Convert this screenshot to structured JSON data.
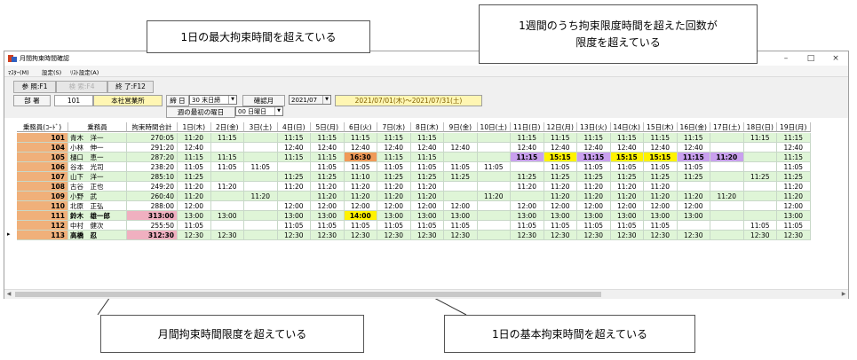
{
  "window": {
    "title": "月間拘束時間確認",
    "controls": [
      "–",
      "□",
      "×"
    ]
  },
  "menu": [
    "ﾏｽﾀｰ(M)",
    "設定(S)",
    "ﾘｽﾄ設定(A)"
  ],
  "toolbar": {
    "ref": "参 照:F1",
    "search": "検 索:F4",
    "exit": "終 了:F12"
  },
  "filters": {
    "dept_label": "部 署",
    "dept_code": "101",
    "dept_name": "本社営業所",
    "closing_label": "締 日",
    "closing_value": "30 末日締",
    "month_label": "確認月",
    "month_value": "2021/07",
    "range": "2021/07/01(木)～2021/07/31(土)",
    "week_label": "週の最初の曜日",
    "week_value": "00 日曜日"
  },
  "grid": {
    "headers": [
      "乗務員(ｺｰﾄﾞ)",
      "乗務員",
      "拘束時間合計",
      "1日(木)",
      "2日(金)",
      "3日(土)",
      "4日(日)",
      "5日(月)",
      "6日(火)",
      "7日(水)",
      "8日(木)",
      "9日(金)",
      "10日(土)",
      "11日(日)",
      "12日(月)",
      "13日(火)",
      "14日(水)",
      "15日(木)",
      "16日(金)",
      "17日(土)",
      "18日(日)",
      "19日(月)"
    ],
    "rows": [
      {
        "code": "101",
        "name": "青木　洋一",
        "total": "270:05",
        "d": [
          "11:20",
          "11:15",
          "",
          "11:15",
          "11:15",
          "11:15",
          "11:15",
          "11:15",
          "",
          "",
          "11:15",
          "11:15",
          "11:15",
          "11:15",
          "11:15",
          "11:15",
          "",
          "11:15",
          "11:15"
        ]
      },
      {
        "code": "104",
        "name": "小林　伸一",
        "total": "291:20",
        "d": [
          "12:40",
          "",
          "",
          "12:40",
          "12:40",
          "12:40",
          "12:40",
          "12:40",
          "12:40",
          "",
          "12:40",
          "12:40",
          "12:40",
          "12:40",
          "12:40",
          "12:40",
          "",
          "",
          "12:40"
        ]
      },
      {
        "code": "105",
        "name": "樋口　恵一",
        "total": "287:20",
        "d": [
          "11:15",
          "11:15",
          "",
          "11:15",
          "11:15",
          "16:30",
          "11:15",
          "11:15",
          "",
          "",
          "11:15",
          "15:15",
          "11:15",
          "15:15",
          "15:15",
          "11:15",
          "11:20",
          "",
          "11:15"
        ]
      },
      {
        "code": "106",
        "name": "谷本　光司",
        "total": "238:20",
        "d": [
          "11:05",
          "11:05",
          "11:05",
          "",
          "11:05",
          "11:05",
          "11:05",
          "11:05",
          "11:05",
          "11:05",
          "",
          "11:05",
          "11:05",
          "11:05",
          "11:05",
          "11:05",
          "",
          "",
          "11:05"
        ]
      },
      {
        "code": "107",
        "name": "山下　洋一",
        "total": "285:10",
        "d": [
          "11:25",
          "",
          "",
          "11:25",
          "11:25",
          "11:10",
          "11:25",
          "11:25",
          "11:25",
          "",
          "11:25",
          "11:25",
          "11:25",
          "11:25",
          "11:25",
          "11:25",
          "",
          "11:25",
          "11:25"
        ]
      },
      {
        "code": "108",
        "name": "古谷　正也",
        "total": "249:20",
        "d": [
          "11:20",
          "11:20",
          "",
          "11:20",
          "11:20",
          "11:20",
          "11:20",
          "11:20",
          "",
          "",
          "11:20",
          "11:20",
          "11:20",
          "11:20",
          "11:20",
          "",
          "",
          "",
          "11:20"
        ]
      },
      {
        "code": "109",
        "name": "小野　武",
        "total": "260:40",
        "d": [
          "11:20",
          "",
          "11:20",
          "",
          "11:20",
          "11:20",
          "11:20",
          "11:20",
          "",
          "11:20",
          "",
          "11:20",
          "11:20",
          "11:20",
          "11:20",
          "11:20",
          "11:20",
          "",
          "11:20"
        ]
      },
      {
        "code": "110",
        "name": "北原　正弘",
        "total": "288:00",
        "d": [
          "12:00",
          "",
          "",
          "12:00",
          "12:00",
          "12:00",
          "12:00",
          "12:00",
          "12:00",
          "",
          "12:00",
          "12:00",
          "12:00",
          "12:00",
          "12:00",
          "12:00",
          "",
          "",
          "12:00"
        ]
      },
      {
        "code": "111",
        "name": "鈴木　雄一郎",
        "total": "313:00",
        "d": [
          "13:00",
          "13:00",
          "",
          "13:00",
          "13:00",
          "14:00",
          "13:00",
          "13:00",
          "13:00",
          "",
          "13:00",
          "13:00",
          "13:00",
          "13:00",
          "13:00",
          "13:00",
          "",
          "",
          "13:00"
        ]
      },
      {
        "code": "112",
        "name": "中村　健次",
        "total": "255:50",
        "d": [
          "11:05",
          "",
          "",
          "11:05",
          "11:05",
          "11:05",
          "11:05",
          "11:05",
          "11:05",
          "",
          "11:05",
          "11:05",
          "11:05",
          "11:05",
          "11:05",
          "",
          "",
          "11:05",
          "11:05"
        ]
      },
      {
        "code": "113",
        "name": "高橋　忍",
        "total": "312:30",
        "d": [
          "12:30",
          "12:30",
          "",
          "12:30",
          "12:30",
          "12:30",
          "12:30",
          "12:30",
          "12:30",
          "",
          "12:30",
          "12:30",
          "12:30",
          "12:30",
          "12:30",
          "12:30",
          "",
          "12:30",
          "12:30"
        ]
      }
    ]
  },
  "callouts": {
    "max_daily": "1日の最大拘束時間を超えている",
    "weekly_line1": "1週間のうち拘束限度時間を超えた回数が",
    "weekly_line2": "限度を超えている",
    "monthly": "月間拘束時間限度を超えている",
    "basic_daily": "1日の基本拘束時間を超えている"
  },
  "colors": {
    "orange": "#f09a58",
    "yellow": "#fff200",
    "purple": "#c9a0ee",
    "pink": "#f0b0c0",
    "green_row": "#dff5d7"
  }
}
